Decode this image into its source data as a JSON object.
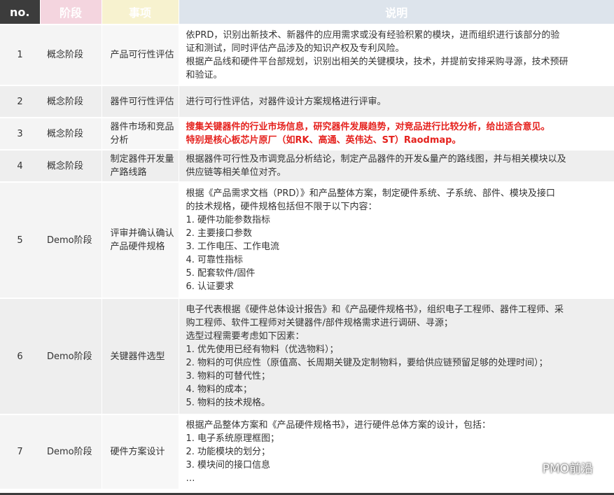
{
  "header": {
    "no": "no.",
    "stage": "阶段",
    "item": "事项",
    "desc": "说明"
  },
  "rows": [
    {
      "no": "1",
      "stage": "概念阶段",
      "item": "产品可行性评估",
      "lines": [
        "依PRD，识别出新技术、新器件的应用需求或没有经验积累的模块，进而组织进行该部分的验",
        "证和测试，同时评估产品涉及的知识产权及专利风险。",
        "根据产品线和硬件平台部规划，识别出相关的关键模块，技术，并提前安排采购寻源，技术预研",
        "和验证。"
      ]
    },
    {
      "no": "2",
      "stage": "概念阶段",
      "item": "器件可行性评估",
      "lines": [
        "进行可行性评估，对器件设计方案规格进行评审。"
      ]
    },
    {
      "no": "3",
      "stage": "概念阶段",
      "item": "器件市场和竞品分析",
      "lines": [
        "搜集关键器件的行业市场信息，研究器件发展趋势，对竞品进行比较分析，给出适合意见。",
        "特别是核心板芯片原厂（如RK、高通、英伟达、ST）Raodmap。"
      ]
    },
    {
      "no": "4",
      "stage": "概念阶段",
      "item": "制定器件开发量产路线路",
      "lines": [
        "根据器件可行性及市调竞品分析结论，制定产品器件的开发&量产的路线图，并与相关模块以及",
        "供应链等相关单位对齐。"
      ]
    },
    {
      "no": "5",
      "stage": "Demo阶段",
      "item": "评审并确认确认产品硬件规格",
      "lines": [
        "根据《产品需求文档（PRD）》和产品整体方案，制定硬件系统、子系统、部件、模块及接口",
        "的技术规格，硬件规格包括但不限于以下内容：",
        "1. 硬件功能参数指标",
        "2. 主要接口参数",
        "3. 工作电压、工作电流",
        "4. 可靠性指标",
        "5. 配套软件/固件",
        "6. 认证要求"
      ]
    },
    {
      "no": "6",
      "stage": "Demo阶段",
      "item": "关键器件选型",
      "lines": [
        "电子代表根据《硬件总体设计报告》和《产品硬件规格书》，组织电子工程师、器件工程师、采",
        "购工程师、软件工程师对关键器件/部件规格需求进行调研、寻源；",
        "选型过程需要考虑如下因素：",
        "1. 优先使用已经有物料（优选物料）；",
        "2. 物料的可供应性（原值高、长周期关键及定制物料，要给供应链预留足够的处理时间）；",
        "3. 物料的可替代性；",
        "4. 物料的成本；",
        "5. 物料的技术规格。"
      ]
    },
    {
      "no": "7",
      "stage": "Demo阶段",
      "item": "硬件方案设计",
      "lines": [
        "根据产品整体方案和《产品硬件规格书》，进行硬件总体方案的设计，包括：",
        "1. 电子系统原理框图；",
        "2. 功能模块的划分；",
        "3.  模块间的接口信息",
        "…"
      ]
    }
  ],
  "watermark": {
    "text": "PMO前沿",
    "icon": "wechat-icon"
  },
  "colors": {
    "header_no": "#3c3c3c",
    "header_stage": "#f4d5df",
    "header_item": "#f7f2cf",
    "header_desc": "#dde4ec",
    "highlight": "#e5211d"
  }
}
